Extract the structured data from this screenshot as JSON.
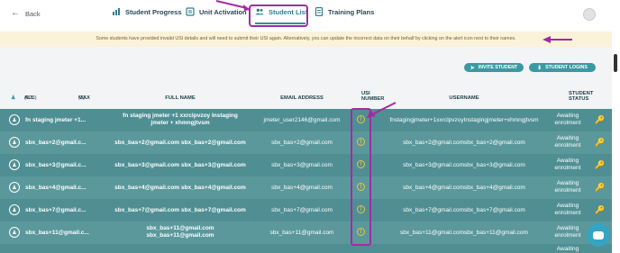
{
  "nav": {
    "back_label": "Back",
    "tabs": [
      {
        "label": "Student Progress",
        "icon": "chart-icon"
      },
      {
        "label": "Unit Activation",
        "icon": "clipboard-icon"
      },
      {
        "label": "Student List",
        "icon": "users-icon",
        "active": true
      },
      {
        "label": "Training Plans",
        "icon": "document-icon"
      }
    ]
  },
  "alert": {
    "text": "Some students have provided invalid USI details and will need to submit their USI again. Alternatively, you can update the incorrect data on their behalf by clicking on the alert icon next to their names."
  },
  "actions": {
    "invite_label": "INVITE STUDENT",
    "login_label": "STUDENT LOGINS"
  },
  "table": {
    "filter_all": "ALL",
    "filter_all_count": "(123)",
    "filter_max": "MAX",
    "filter_max_count": "(3)",
    "headers": {
      "full_name": "FULL NAME",
      "email": "EMAIL ADDRESS",
      "usi_line1": "USI",
      "usi_line2": "NUMBER",
      "username": "USERNAME",
      "status_line1": "STUDENT",
      "status_line2": "STATUS"
    },
    "rows": [
      {
        "name": "fn staging jmeter +1...",
        "full1": "fn staging jmeter +1 xxrclpvzoy Instaging",
        "full2": "jmeter + xhmngjtvsm",
        "email": "jmeter_user2146@gmail.com",
        "username": "fnstagingjmeter+1xxrclpvzoyInstagingjmeter+xhmngjtvsm",
        "status1": "Awaiting",
        "status2": "enrolment"
      },
      {
        "name": "sbx_bas+2@gmail.c...",
        "full1": "sbx_bas+2@gmail.com sbx_bas+2@gmail.com",
        "full2": "",
        "email": "sbx_bas+2@gmail.com",
        "username": "sbx_bas+2@gmail.comsbx_bas+2@gmail.com",
        "status1": "Awaiting",
        "status2": "enrolment"
      },
      {
        "name": "sbx_bas+3@gmail.c...",
        "full1": "sbx_bas+3@gmail.com sbx_bas+3@gmail.com",
        "full2": "",
        "email": "sbx_bas+3@gmail.com",
        "username": "sbx_bas+3@gmail.comsbx_bas+3@gmail.com",
        "status1": "Awaiting",
        "status2": "enrolment"
      },
      {
        "name": "sbx_bas+4@gmail.c...",
        "full1": "sbx_bas+4@gmail.com sbx_bas+4@gmail.com",
        "full2": "",
        "email": "sbx_bas+4@gmail.com",
        "username": "sbx_bas+4@gmail.comsbx_bas+4@gmail.com",
        "status1": "Awaiting",
        "status2": "enrolment"
      },
      {
        "name": "sbx_bas+7@gmail.c...",
        "full1": "sbx_bas+7@gmail.com sbx_bas+7@gmail.com",
        "full2": "",
        "email": "sbx_bas+7@gmail.com",
        "username": "sbx_bas+7@gmail.comsbx_bas+7@gmail.com",
        "status1": "Awaiting",
        "status2": "enrolment"
      },
      {
        "name": "sbx_bas+11@gmail.c...",
        "full1": "sbx_bas+11@gmail.com",
        "full2": "sbx_bas+11@gmail.com",
        "email": "sbx_bas+11@gmail.com",
        "username": "sbx_bas+11@gmail.comsbx_bas+11@gmail.com",
        "status1": "Awaiting",
        "status2": "enrolment"
      }
    ],
    "last_row_status": "Awaiting"
  },
  "colors": {
    "accent": "#3a9aa3",
    "row_bg": "#4f8f94",
    "annotation": "#a12ca1",
    "warning": "#f0c23b",
    "alert_bg": "#fbf2da"
  }
}
